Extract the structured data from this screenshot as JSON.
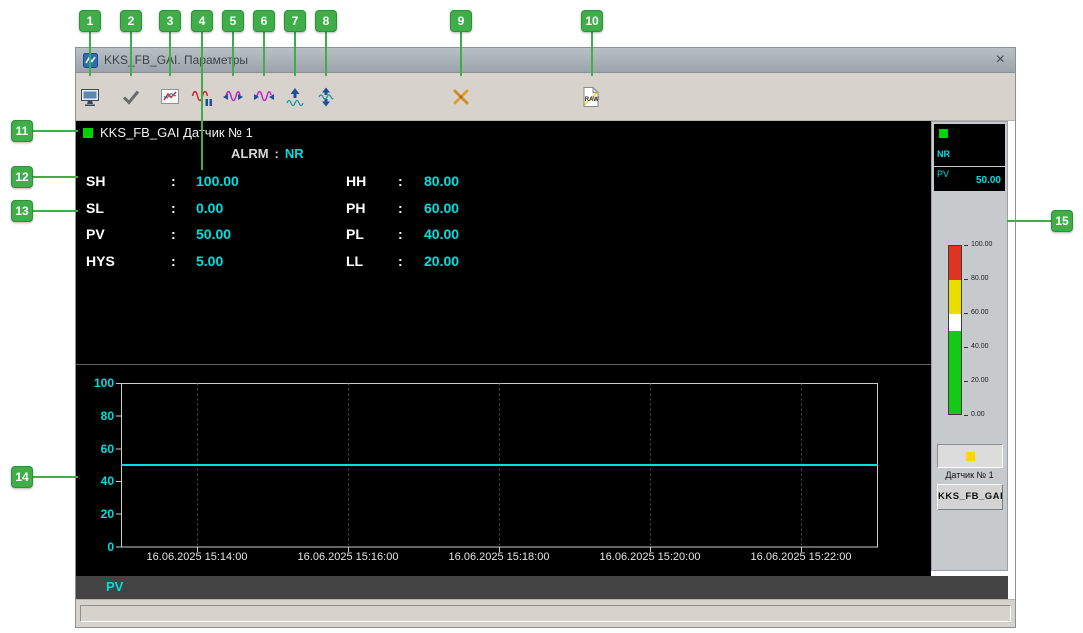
{
  "window": {
    "title": "KKS_FB_GAI. Параметры",
    "close": "×"
  },
  "toolbar": {
    "icons": [
      "monitor-print-icon",
      "check-icon",
      "chart-image-icon",
      "wave-pause-icon",
      "wave-arrows-in-icon",
      "wave-arrows-out-icon",
      "arrow-up-icon",
      "arrows-up-down-icon",
      "tools-icon",
      "raw-document-icon"
    ]
  },
  "params_panel": {
    "status_color": "#00d400",
    "title": "KKS_FB_GAI Датчик № 1",
    "alarm_label": "ALRM",
    "colon": ":",
    "alarm_value": "NR",
    "rows": [
      {
        "l": "SH",
        "lv": "100.00",
        "r": "HH",
        "rv": "80.00"
      },
      {
        "l": "SL",
        "lv": "0.00",
        "r": "PH",
        "rv": "60.00"
      },
      {
        "l": "PV",
        "lv": "50.00",
        "r": "PL",
        "rv": "40.00"
      },
      {
        "l": "HYS",
        "lv": "5.00",
        "r": "LL",
        "rv": "20.00"
      }
    ]
  },
  "chart_data": {
    "type": "line",
    "title": "",
    "x_labels": [
      "16.06.2025 15:14:00",
      "16.06.2025 15:16:00",
      "16.06.2025 15:18:00",
      "16.06.2025 15:20:00",
      "16.06.2025 15:22:00"
    ],
    "yticks": [
      "100",
      "80",
      "60",
      "40",
      "20",
      "0"
    ],
    "ylim": [
      0,
      100
    ],
    "grid": "vertical-dashed",
    "series": [
      {
        "name": "PV",
        "color": "#00dfdf",
        "values": [
          50,
          50,
          50,
          50,
          50
        ]
      }
    ],
    "legend": "PV",
    "legend_position": "bottom-strip"
  },
  "legend": {
    "pv": "PV"
  },
  "sidebar": {
    "status_value": "NR",
    "status_color": "#00d400",
    "pv_label": "PV",
    "pv_value": "50.00",
    "gauge": {
      "ticks": [
        "100.00",
        "80.00",
        "60.00",
        "40.00",
        "20.00",
        "0.00"
      ],
      "zones": [
        {
          "from": 80,
          "to": 100,
          "color": "#e23222"
        },
        {
          "from": 60,
          "to": 80,
          "color": "#e8de00"
        },
        {
          "from": 50,
          "to": 60,
          "color": "#ffffff"
        },
        {
          "from": 0,
          "to": 50,
          "color": "#16c916"
        }
      ],
      "value": 50
    },
    "alarm_indicator_color": "#ffd400",
    "sensor_name": "Датчик № 1",
    "kks_label": "KKS_FB_GAI"
  },
  "badges": [
    "1",
    "2",
    "3",
    "4",
    "5",
    "6",
    "7",
    "8",
    "9",
    "10",
    "11",
    "12",
    "13",
    "14",
    "15"
  ],
  "statusbar": {
    "text": ""
  }
}
